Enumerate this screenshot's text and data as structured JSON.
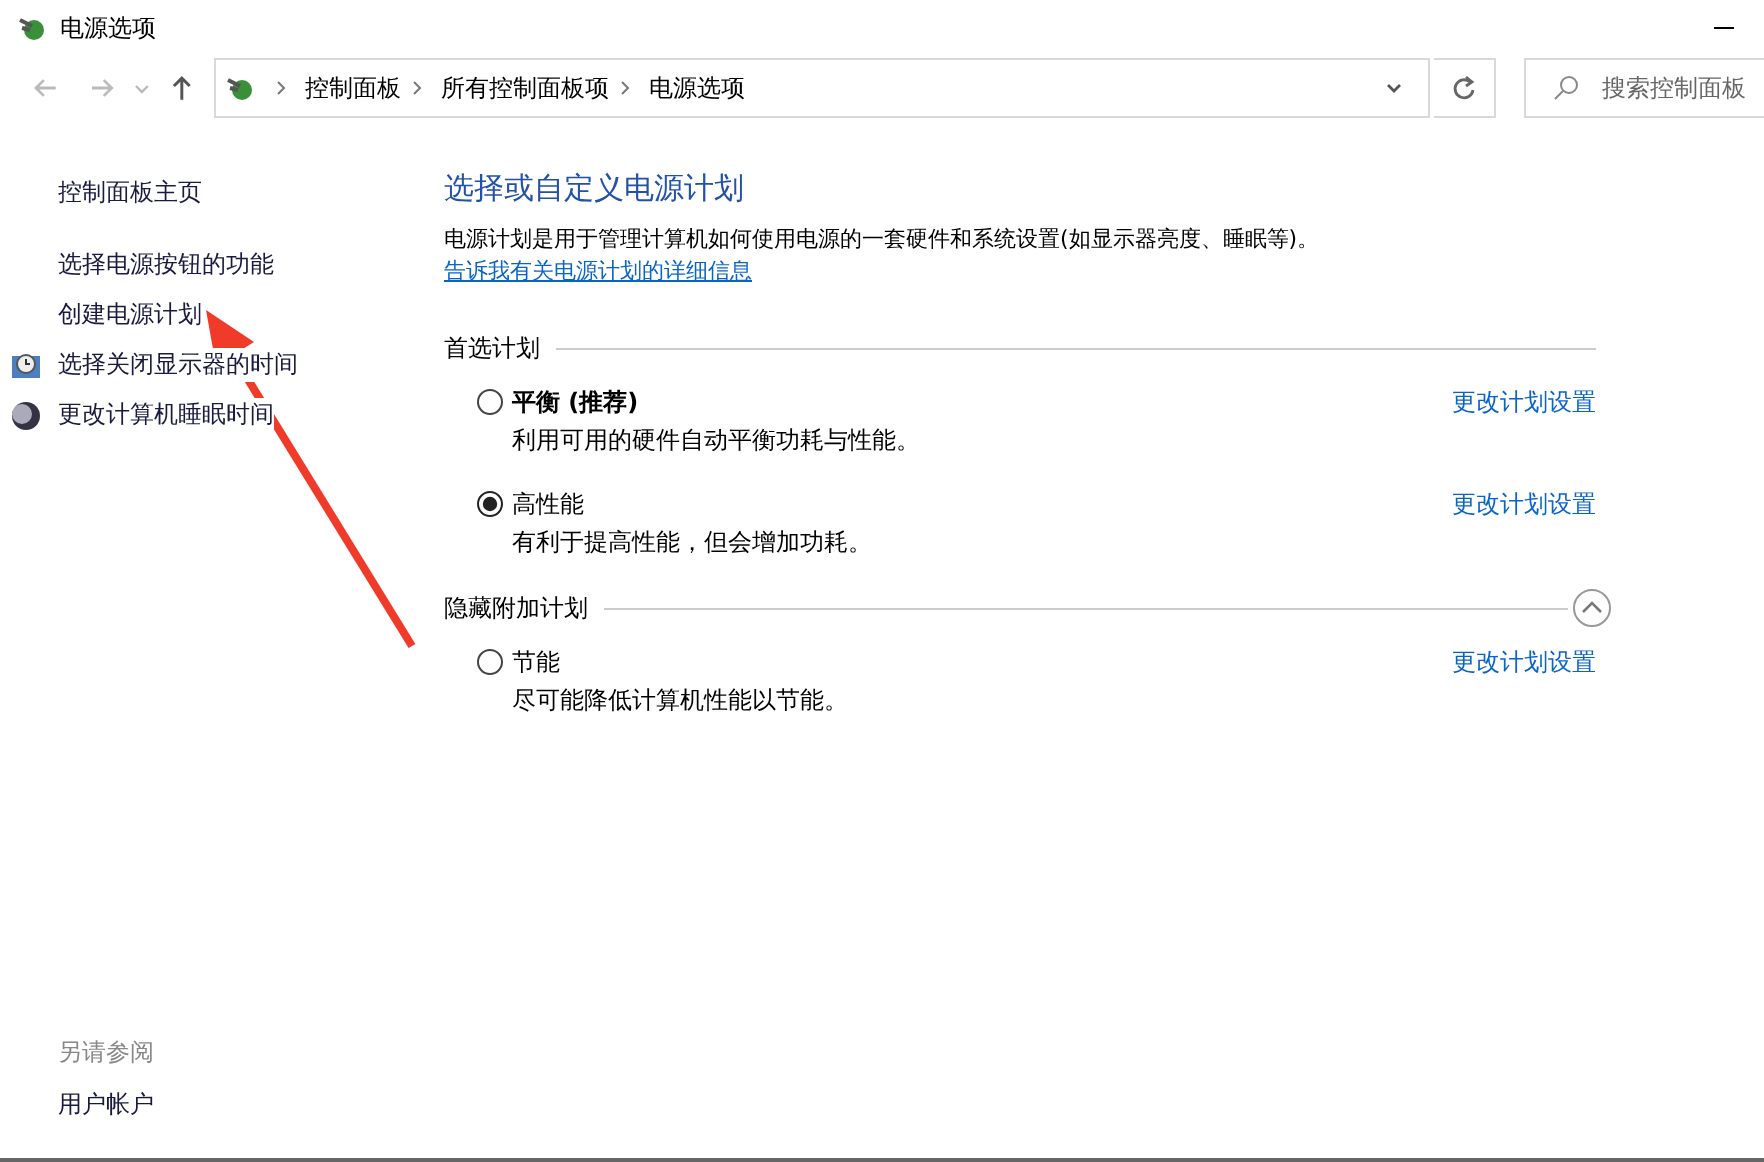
{
  "window": {
    "title": "电源选项"
  },
  "address_bar": {
    "crumbs": [
      "控制面板",
      "所有控制面板项",
      "电源选项"
    ]
  },
  "search": {
    "placeholder": "搜索控制面板"
  },
  "sidebar": {
    "items": [
      {
        "label": "控制面板主页"
      },
      {
        "label": "选择电源按钮的功能"
      },
      {
        "label": "创建电源计划"
      },
      {
        "label": "选择关闭显示器的时间"
      },
      {
        "label": "更改计算机睡眠时间"
      }
    ],
    "see_also": {
      "heading": "另请参阅",
      "links": [
        "用户帐户"
      ]
    }
  },
  "main": {
    "title": "选择或自定义电源计划",
    "description": "电源计划是用于管理计算机如何使用电源的一套硬件和系统设置(如显示器亮度、睡眠等)。",
    "description_link": "告诉我有关电源计划的详细信息",
    "sections": [
      {
        "heading": "首选计划",
        "plans": [
          {
            "name": "平衡 (推荐)",
            "bold": true,
            "selected": false,
            "description": "利用可用的硬件自动平衡功耗与性能。",
            "link": "更改计划设置"
          },
          {
            "name": "高性能",
            "bold": false,
            "selected": true,
            "description": "有利于提高性能，但会增加功耗。",
            "link": "更改计划设置"
          }
        ]
      },
      {
        "heading": "隐藏附加计划",
        "expanded": true,
        "plans": [
          {
            "name": "节能",
            "bold": false,
            "selected": false,
            "description": "尽可能降低计算机性能以节能。",
            "link": "更改计划设置"
          }
        ]
      }
    ]
  },
  "annotation": {
    "kind": "arrow"
  }
}
